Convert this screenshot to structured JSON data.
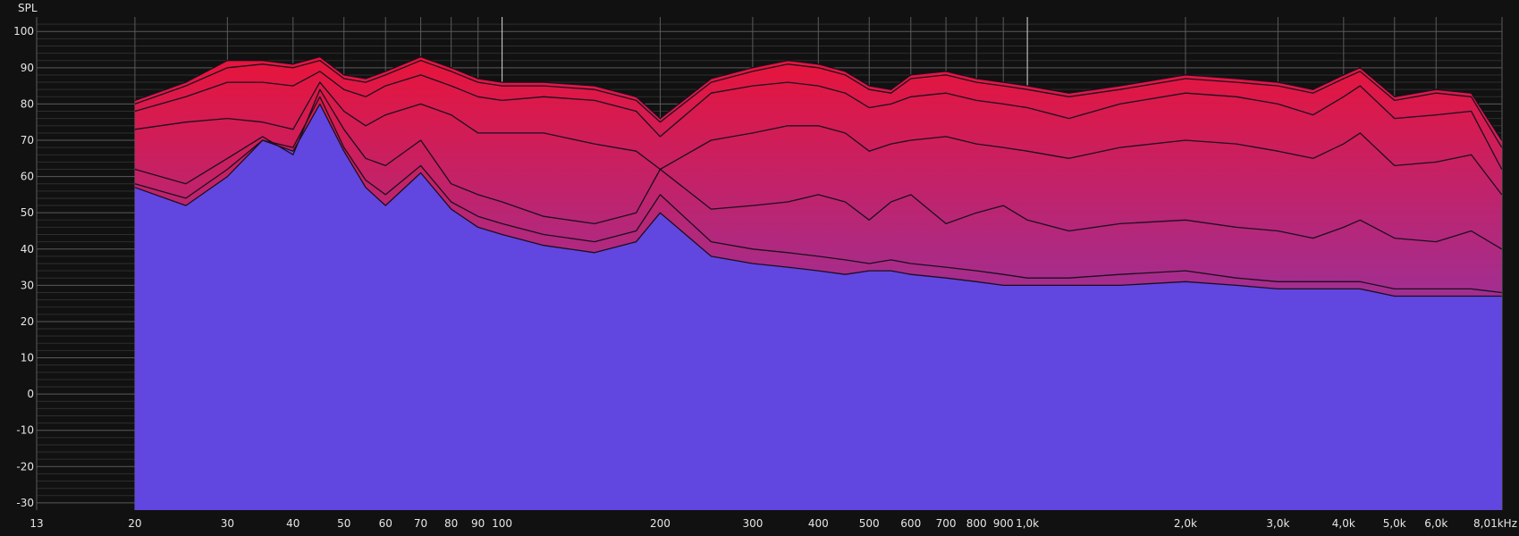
{
  "chart_data": {
    "type": "area",
    "ylabel": "SPL",
    "xscale": "log",
    "xlim": [
      13,
      8010
    ],
    "ylim": [
      -32,
      104
    ],
    "grid": true,
    "y_ticks": [
      100,
      90,
      80,
      70,
      60,
      50,
      40,
      30,
      20,
      10,
      0,
      -10,
      -20,
      -30
    ],
    "y_tick_labels": [
      "100",
      "90",
      "80",
      "70",
      "60",
      "50",
      "40",
      "30",
      "20",
      "10",
      "0",
      "-10",
      "-20",
      "-30"
    ],
    "x_ticks": [
      13,
      20,
      30,
      40,
      50,
      60,
      70,
      80,
      90,
      100,
      200,
      300,
      400,
      500,
      600,
      700,
      800,
      900,
      1000,
      2000,
      3000,
      4000,
      5000,
      6000,
      8010
    ],
    "x_tick_labels": [
      "13",
      "20",
      "30",
      "40",
      "50",
      "60",
      "70",
      "80",
      "90",
      "100",
      "200",
      "300",
      "400",
      "500",
      "600",
      "700",
      "800",
      "900",
      "1,0k",
      "2,0k",
      "3,0k",
      "4,0k",
      "5,0k",
      "6,0k",
      "8,01kHz"
    ],
    "markers": [
      100,
      1000
    ],
    "fill_colors": {
      "top": "#e8143a",
      "bottom": "#6246e0"
    },
    "x": [
      20,
      25,
      30,
      35,
      40,
      45,
      50,
      55,
      60,
      70,
      80,
      90,
      100,
      120,
      150,
      180,
      200,
      250,
      300,
      350,
      400,
      450,
      500,
      550,
      600,
      700,
      800,
      900,
      1000,
      1200,
      1500,
      2000,
      2500,
      3000,
      3500,
      4000,
      4300,
      5000,
      6000,
      7000,
      8000
    ],
    "series": [
      {
        "values": [
          81,
          86,
          92,
          92,
          91,
          93,
          88,
          87,
          89,
          93,
          90,
          87,
          86,
          86,
          85,
          82,
          76,
          87,
          90,
          92,
          91,
          89,
          85,
          84,
          88,
          89,
          87,
          86,
          85,
          83,
          85,
          88,
          87,
          86,
          84,
          88,
          90,
          82,
          84,
          83,
          70
        ]
      },
      {
        "values": [
          80,
          85,
          90,
          91,
          90,
          92,
          87,
          86,
          88,
          92,
          89,
          86,
          85,
          85,
          84,
          81,
          75,
          86,
          89,
          91,
          90,
          88,
          84,
          83,
          87,
          88,
          86,
          85,
          84,
          82,
          84,
          87,
          86,
          85,
          83,
          87,
          89,
          81,
          83,
          82,
          68
        ]
      },
      {
        "values": [
          78,
          82,
          86,
          86,
          85,
          89,
          84,
          82,
          85,
          88,
          85,
          82,
          81,
          82,
          81,
          78,
          71,
          83,
          85,
          86,
          85,
          83,
          79,
          80,
          82,
          83,
          81,
          80,
          79,
          76,
          80,
          83,
          82,
          80,
          77,
          82,
          85,
          76,
          77,
          78,
          62
        ]
      },
      {
        "values": [
          73,
          75,
          76,
          75,
          73,
          86,
          78,
          74,
          77,
          80,
          77,
          72,
          72,
          72,
          69,
          67,
          62,
          70,
          72,
          74,
          74,
          72,
          67,
          69,
          70,
          71,
          69,
          68,
          67,
          65,
          68,
          70,
          69,
          67,
          65,
          69,
          72,
          63,
          64,
          66,
          55
        ]
      },
      {
        "values": [
          62,
          58,
          65,
          71,
          66,
          84,
          73,
          65,
          63,
          70,
          58,
          55,
          53,
          49,
          47,
          50,
          62,
          51,
          52,
          53,
          55,
          53,
          48,
          53,
          55,
          47,
          50,
          52,
          48,
          45,
          47,
          48,
          46,
          45,
          43,
          46,
          48,
          43,
          42,
          45,
          40
        ]
      },
      {
        "values": [
          58,
          54,
          62,
          70,
          68,
          82,
          68,
          59,
          55,
          63,
          53,
          49,
          47,
          44,
          42,
          45,
          55,
          42,
          40,
          39,
          38,
          37,
          36,
          37,
          36,
          35,
          34,
          33,
          32,
          32,
          33,
          34,
          32,
          31,
          31,
          31,
          31,
          29,
          29,
          29,
          28
        ]
      },
      {
        "values": [
          57,
          52,
          60,
          70,
          67,
          80,
          67,
          57,
          52,
          61,
          51,
          46,
          44,
          41,
          39,
          42,
          50,
          38,
          36,
          35,
          34,
          33,
          34,
          34,
          33,
          32,
          31,
          30,
          30,
          30,
          30,
          31,
          30,
          29,
          29,
          29,
          29,
          27,
          27,
          27,
          27
        ]
      }
    ]
  }
}
